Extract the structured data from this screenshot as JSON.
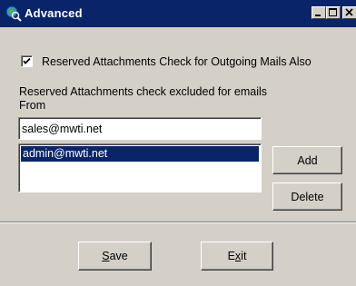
{
  "window": {
    "title": "Advanced",
    "icon": "globe-magnifier-icon",
    "controls": [
      "minimize-icon",
      "maximize-icon",
      "close-icon"
    ]
  },
  "options": {
    "outgoing_check_label": "Reserved Attachments Check for Outgoing Mails Also",
    "outgoing_check_checked": true,
    "excluded_label": "Reserved Attachments check excluded for emails From"
  },
  "email_input": {
    "value": "sales@mwti.net"
  },
  "excluded_list": {
    "items": [
      "admin@mwti.net"
    ],
    "selected_index": 0
  },
  "buttons": {
    "add": "Add",
    "delete": "Delete",
    "save_prefix": "",
    "save_key": "S",
    "save_rest": "ave",
    "exit_prefix": "E",
    "exit_key": "x",
    "exit_rest": "it"
  },
  "colors": {
    "titlebar": "#0a246a",
    "face": "#d4d0c8",
    "selection": "#0a246a"
  }
}
